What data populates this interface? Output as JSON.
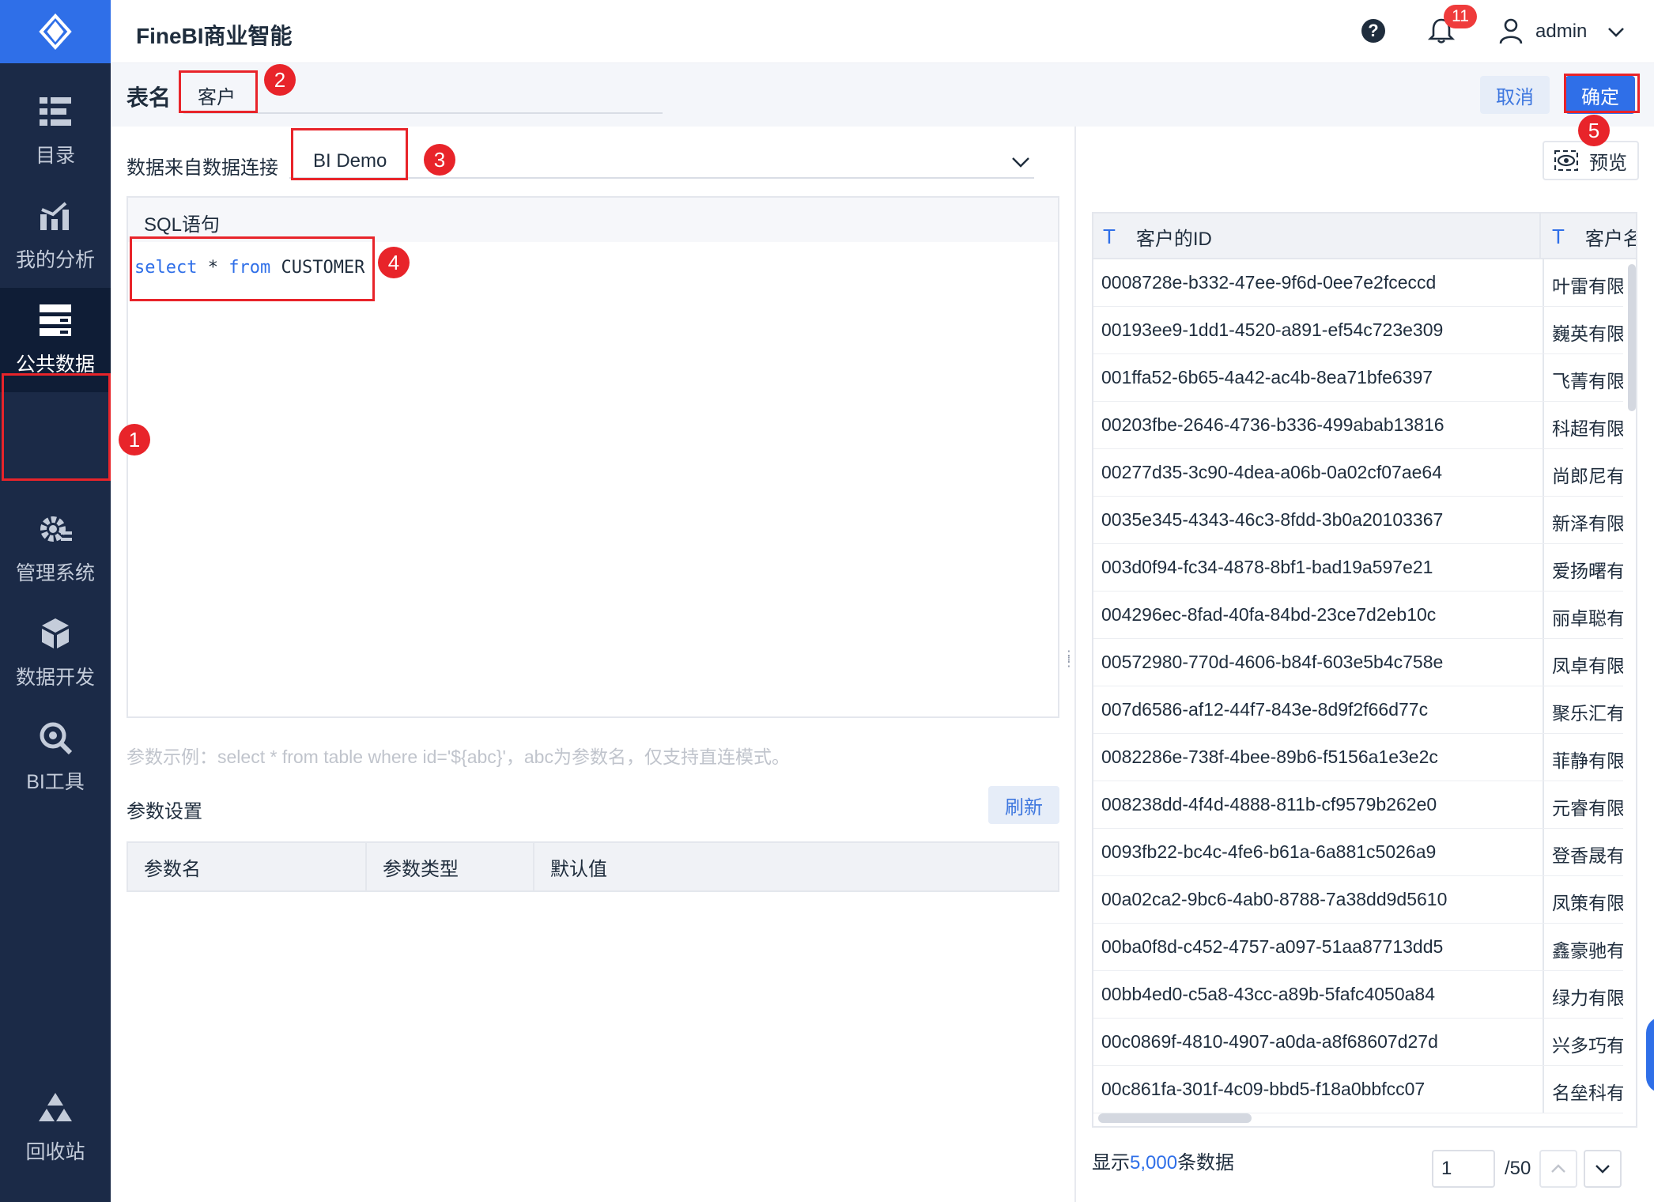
{
  "header": {
    "app_title": "FineBI商业智能",
    "notification_count": "11",
    "user_name": "admin"
  },
  "sidebar": {
    "items": [
      {
        "label": "目录",
        "icon": "catalog-icon"
      },
      {
        "label": "我的分析",
        "icon": "analysis-chart-icon"
      },
      {
        "label": "公共数据",
        "icon": "public-data-icon",
        "active": true
      },
      {
        "label": "管理系统",
        "icon": "gear-manage-icon"
      },
      {
        "label": "数据开发",
        "icon": "data-dev-cube-icon"
      },
      {
        "label": "BI工具",
        "icon": "bi-tool-icon"
      },
      {
        "label": "回收站",
        "icon": "recycle-bin-icon"
      }
    ]
  },
  "form": {
    "name_label": "表名",
    "name_value": "客户",
    "cancel_label": "取消",
    "ok_label": "确定",
    "connection_label": "数据来自数据连接",
    "connection_value": "BI Demo",
    "sql_title": "SQL语句",
    "sql_kw1": "select",
    "sql_mid": " * ",
    "sql_kw2": "from",
    "sql_table": " CUSTOMER",
    "param_hint": "参数示例：select * from table where id='${abc}'，abc为参数名，仅支持直连模式。",
    "param_section_title": "参数设置",
    "refresh_label": "刷新",
    "param_columns": [
      "参数名",
      "参数类型",
      "默认值"
    ]
  },
  "preview": {
    "button_label": "预览",
    "columns": [
      "客户的ID",
      "客户名称"
    ],
    "rows": [
      [
        "0008728e-b332-47ee-9f6d-0ee7e2fceccd",
        "叶雷有限"
      ],
      [
        "00193ee9-1dd1-4520-a891-ef54c723e309",
        "巍英有限"
      ],
      [
        "001ffa52-6b65-4a42-ac4b-8ea71bfe6397",
        "飞菁有限"
      ],
      [
        "00203fbe-2646-4736-b336-499abab13816",
        "科超有限"
      ],
      [
        "00277d35-3c90-4dea-a06b-0a02cf07ae64",
        "尚郎尼有"
      ],
      [
        "0035e345-4343-46c3-8fdd-3b0a20103367",
        "新泽有限"
      ],
      [
        "003d0f94-fc34-4878-8bf1-bad19a597e21",
        "爱扬曙有"
      ],
      [
        "004296ec-8fad-40fa-84bd-23ce7d2eb10c",
        "丽卓聪有"
      ],
      [
        "00572980-770d-4606-b84f-603e5b4c758e",
        "凤卓有限"
      ],
      [
        "007d6586-af12-44f7-843e-8d9f2f66d77c",
        "聚乐汇有"
      ],
      [
        "0082286e-738f-4bee-89b6-f5156a1e3e2c",
        "菲静有限"
      ],
      [
        "008238dd-4f4d-4888-811b-cf9579b262e0",
        "元睿有限"
      ],
      [
        "0093fb22-bc4c-4fe6-b61a-6a881c5026a9",
        "登香晟有"
      ],
      [
        "00a02ca2-9bc6-4ab0-8788-7a38dd9d5610",
        "凤策有限"
      ],
      [
        "00ba0f8d-c452-4757-a097-51aa87713dd5",
        "鑫豪驰有"
      ],
      [
        "00bb4ed0-c5a8-43cc-a89b-5fafc4050a84",
        "绿力有限"
      ],
      [
        "00c0869f-4810-4907-a0da-a8f68607d27d",
        "兴多巧有"
      ],
      [
        "00c861fa-301f-4c09-bbd5-f18a0bbfcc07",
        "名垒科有"
      ]
    ],
    "footer_prefix": "显示",
    "footer_count": "5,000",
    "footer_suffix": "条数据",
    "page_current": "1",
    "page_total": "/50"
  },
  "annotations": {
    "marker_1": "1",
    "marker_2": "2",
    "marker_3": "3",
    "marker_4": "4",
    "marker_5": "5"
  },
  "colors": {
    "accent": "#2f6fe8",
    "sidebar_bg": "#1b2a47",
    "highlight": "#e8242a"
  }
}
